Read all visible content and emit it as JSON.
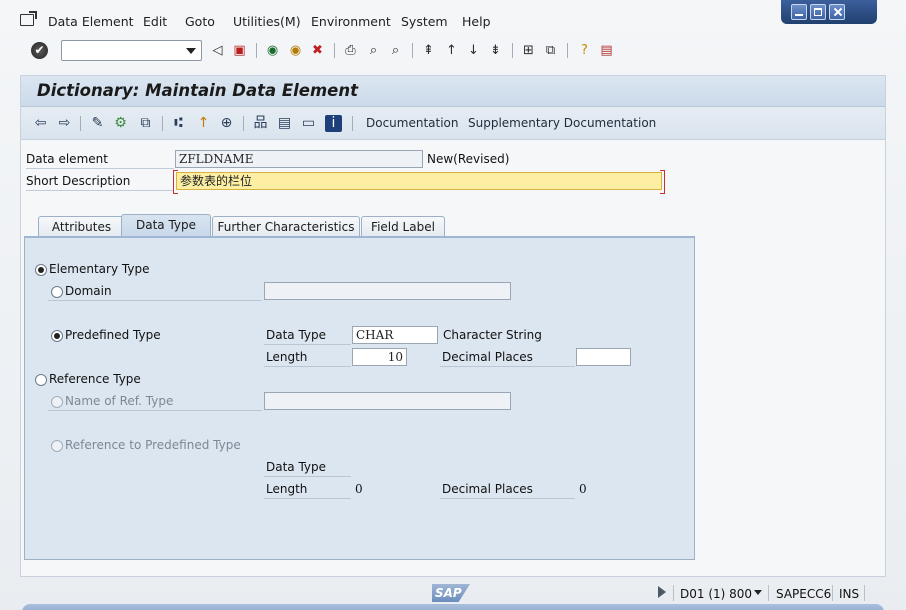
{
  "menubar": {
    "items": [
      "Data Element",
      "Edit",
      "Goto",
      "Utilities(M)",
      "Environment",
      "System",
      "Help"
    ]
  },
  "toolbar": {
    "command_value": ""
  },
  "screen": {
    "title": "Dictionary: Maintain Data Element",
    "app_links": [
      "Documentation",
      "Supplementary Documentation"
    ]
  },
  "header_fields": {
    "data_element_label": "Data element",
    "data_element_value": "ZFLDNAME",
    "status": "New(Revised)",
    "short_desc_label": "Short Description",
    "short_desc_value": "参数表的栏位"
  },
  "tabs": [
    {
      "label": "Attributes",
      "active": false
    },
    {
      "label": "Data Type",
      "active": true
    },
    {
      "label": "Further Characteristics",
      "active": false
    },
    {
      "label": "Field Label",
      "active": false
    }
  ],
  "data_type": {
    "elementary_label": "Elementary Type",
    "domain_label": "Domain",
    "domain_value": "",
    "predefined_label": "Predefined Type",
    "pd_data_type_label": "Data Type",
    "pd_data_type_value": "CHAR",
    "pd_data_type_desc": "Character String",
    "pd_length_label": "Length",
    "pd_length_value": "10",
    "pd_decimal_label": "Decimal Places",
    "pd_decimal_value": "",
    "reference_label": "Reference Type",
    "ref_name_label": "Name of Ref. Type",
    "ref_name_value": "",
    "ref_predef_label": "Reference to Predefined Type",
    "rp_data_type_label": "Data Type",
    "rp_length_label": "Length",
    "rp_length_value": "0",
    "rp_decimal_label": "Decimal Places",
    "rp_decimal_value": "0"
  },
  "status": {
    "system": "D01 (1) 800",
    "server": "SAPECC6",
    "mode": "INS",
    "logo": "SAP"
  }
}
